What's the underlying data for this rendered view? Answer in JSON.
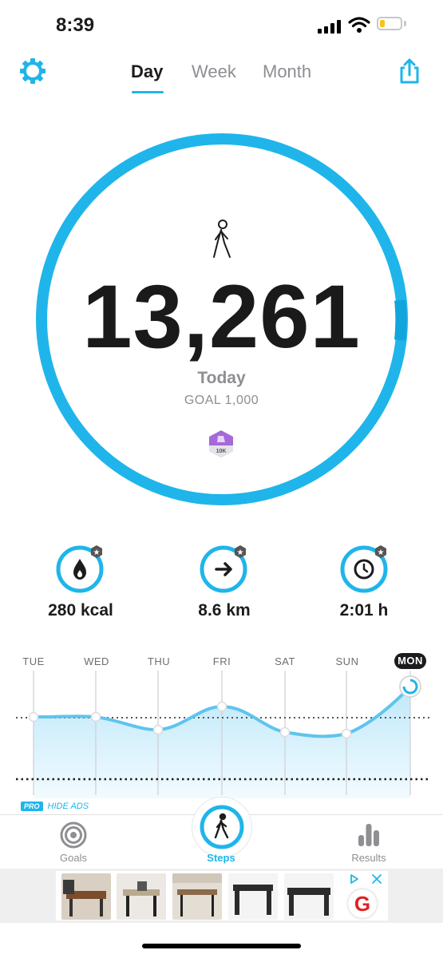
{
  "status": {
    "time": "8:39",
    "battery_color": "#f5c518"
  },
  "header": {
    "settings_icon": "gear-icon",
    "tabs": [
      {
        "label": "Day",
        "active": true
      },
      {
        "label": "Week",
        "active": false
      },
      {
        "label": "Month",
        "active": false
      }
    ],
    "share_icon": "share-icon"
  },
  "summary": {
    "steps": "13,261",
    "period_label": "Today",
    "goal_label": "GOAL 1,000",
    "badge_text": "10K",
    "ring_progress": 1.0,
    "accent_color": "#1fb5ea"
  },
  "stats": [
    {
      "icon": "flame-icon",
      "value": "280 kcal"
    },
    {
      "icon": "arrow-right-icon",
      "value": "8.6 km"
    },
    {
      "icon": "clock-icon",
      "value": "2:01 h"
    }
  ],
  "week_chart": {
    "days": [
      "TUE",
      "WED",
      "THU",
      "FRI",
      "SAT",
      "SUN",
      "MON"
    ],
    "active_day": "MON"
  },
  "promo": {
    "tag": "PRO",
    "text": "HIDE ADS"
  },
  "tabbar": [
    {
      "label": "Goals",
      "icon": "target-icon",
      "active": false
    },
    {
      "label": "Steps",
      "icon": "walker-icon",
      "active": true
    },
    {
      "label": "Results",
      "icon": "bar-chart-icon",
      "active": false
    }
  ],
  "ad": {
    "logo_letter": "G"
  }
}
